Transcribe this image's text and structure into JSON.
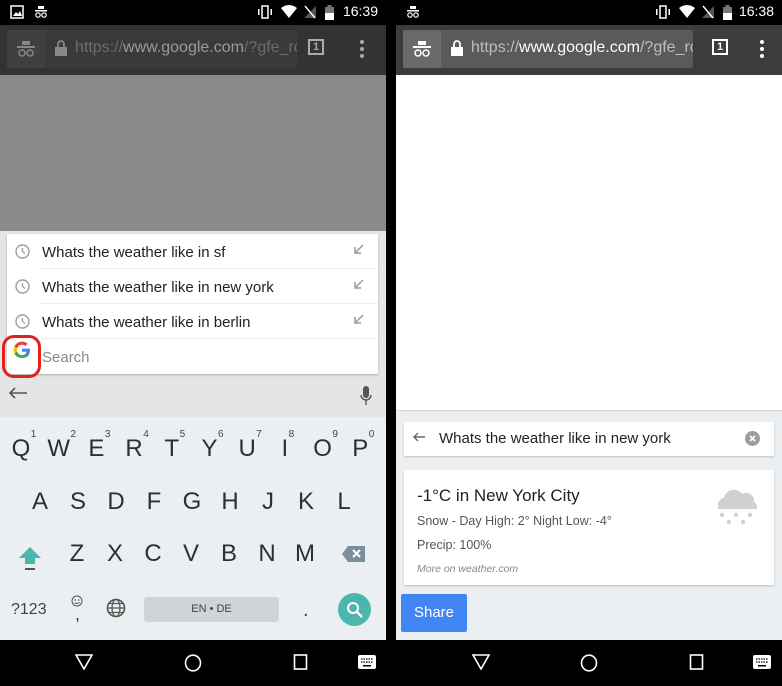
{
  "left": {
    "status": {
      "time": "16:39"
    },
    "toolbar": {
      "url_scheme": "https://",
      "url_host": "www.google.com",
      "url_rest": "/?gfe_rc",
      "tab_count": "1"
    },
    "suggestions": [
      {
        "text": "Whats the weather like in sf"
      },
      {
        "text": "Whats the weather like in new york"
      },
      {
        "text": "Whats the weather like in berlin"
      }
    ],
    "search_placeholder": "Search",
    "keyboard": {
      "row1": [
        {
          "key": "Q",
          "num": "1"
        },
        {
          "key": "W",
          "num": "2"
        },
        {
          "key": "E",
          "num": "3"
        },
        {
          "key": "R",
          "num": "4"
        },
        {
          "key": "T",
          "num": "5"
        },
        {
          "key": "Y",
          "num": "6"
        },
        {
          "key": "U",
          "num": "7"
        },
        {
          "key": "I",
          "num": "8"
        },
        {
          "key": "O",
          "num": "9"
        },
        {
          "key": "P",
          "num": "0"
        }
      ],
      "row2": [
        "A",
        "S",
        "D",
        "F",
        "G",
        "H",
        "J",
        "K",
        "L"
      ],
      "row3": [
        "Z",
        "X",
        "C",
        "V",
        "B",
        "N",
        "M"
      ],
      "symbols_label": "?123",
      "comma_label": ",",
      "space_label": "EN • DE",
      "period_label": "."
    }
  },
  "right": {
    "status": {
      "time": "16:38"
    },
    "toolbar": {
      "url_scheme": "https://",
      "url_host": "www.google.com",
      "url_rest": "/?gfe_rc",
      "tab_count": "1"
    },
    "query": "Whats the weather like in new york",
    "weather": {
      "title": "-1°C in New York City",
      "details": "Snow - Day High: 2° Night Low: -4°",
      "precip": "Precip: 100%",
      "source": "More on weather.com",
      "icon": "snow-cloud-icon"
    },
    "share_label": "Share"
  },
  "colors": {
    "accent_teal": "#4db6ac",
    "share_blue": "#4285f4",
    "highlight_red": "#e32117"
  }
}
